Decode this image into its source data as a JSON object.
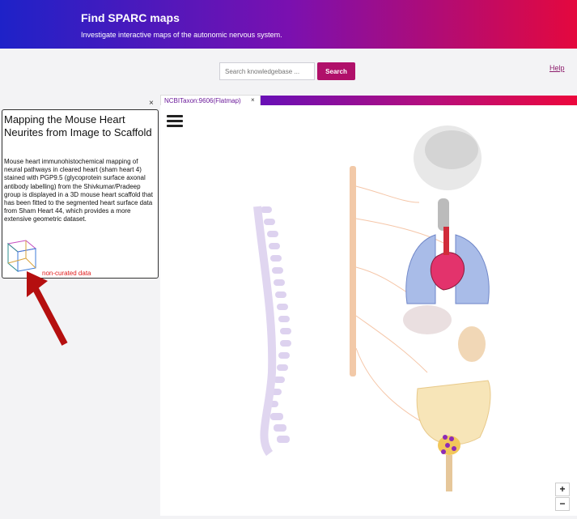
{
  "header": {
    "title": "Find SPARC maps",
    "subtitle": "Investigate interactive maps of the autonomic nervous system."
  },
  "search": {
    "placeholder": "Search knowledgebase ...",
    "button_label": "Search"
  },
  "help_link": "Help",
  "tab": {
    "label": "NCBITaxon:9606(Flatmap)",
    "close": "×"
  },
  "popup": {
    "close": "×",
    "title": "Mapping the Mouse Heart Neurites from Image to Scaffold",
    "description": "Mouse heart immunohistochemical mapping of neural pathways in cleared heart (sham heart 4) stained with PGP9.5 (glycoprotein surface axonal antibody labelling) from the Shivkumar/Pradeep group is displayed in a 3D mouse heart scaffold that has been fitted to the segmented heart surface data from Sham Heart 44, which provides a more extensive geometric dataset.",
    "tag": "non-curated data"
  },
  "zoom": {
    "in": "+",
    "out": "−"
  },
  "colors": {
    "brand_start": "#1e22c8",
    "brand_end": "#e4083e",
    "button": "#b0106a",
    "annotation_arrow": "#b50f0f"
  }
}
